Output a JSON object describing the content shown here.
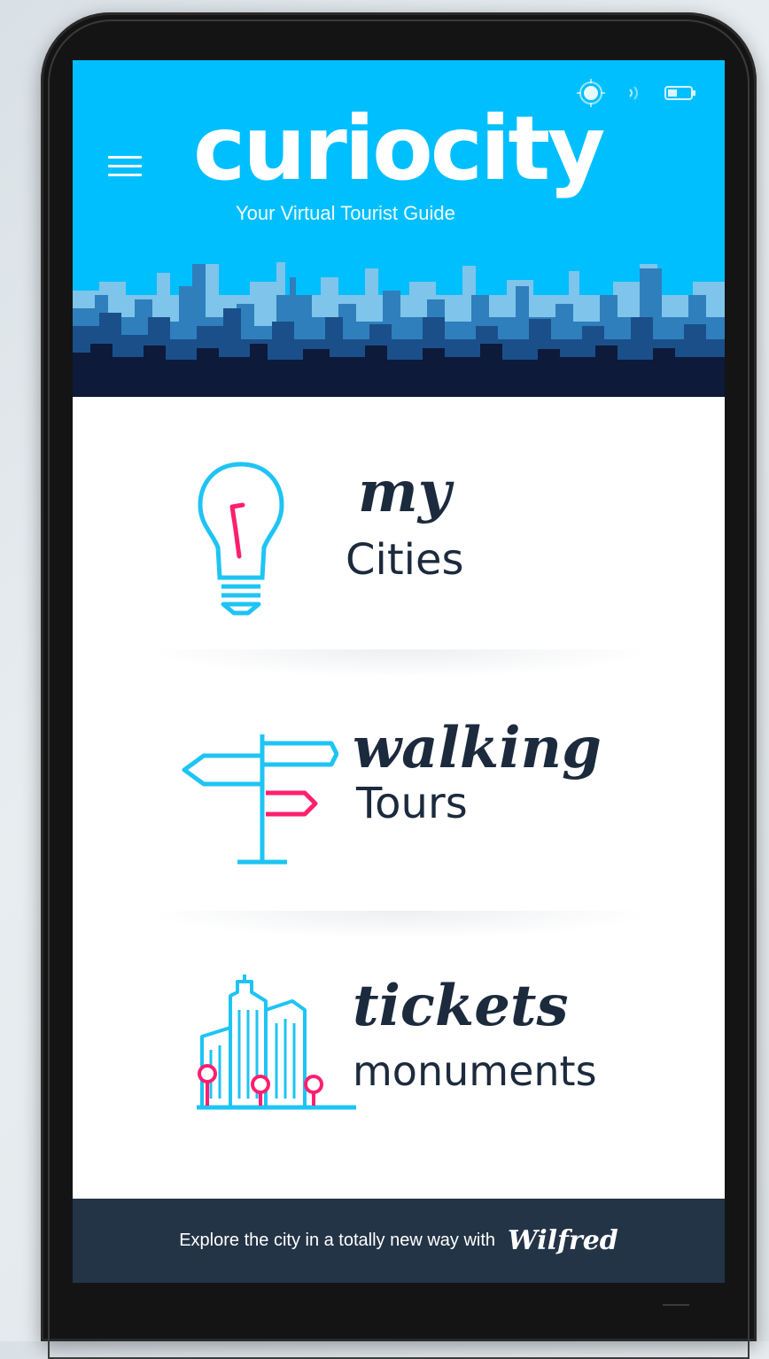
{
  "app": {
    "brand_name": "curiocity",
    "tagline": "Your Virtual Tourist Guide"
  },
  "status_bar": {
    "icons": [
      "location-icon",
      "signal-icon",
      "battery-icon"
    ]
  },
  "menu": {
    "items": [
      {
        "script": "my",
        "label": "Cities",
        "icon": "lightbulb-icon"
      },
      {
        "script": "walking",
        "label": "Tours",
        "icon": "signpost-icon"
      },
      {
        "script": "tickets",
        "label": "monuments",
        "icon": "buildings-icon"
      }
    ]
  },
  "footer": {
    "text": "Explore the city in a totally new way with",
    "brand": "Wilfred"
  },
  "colors": {
    "header_bg": "#00bfff",
    "accent_pink": "#ff1f6e",
    "icon_cyan": "#1ec4f4",
    "text_dark": "#1c2a3d",
    "footer_bg": "#243447"
  }
}
